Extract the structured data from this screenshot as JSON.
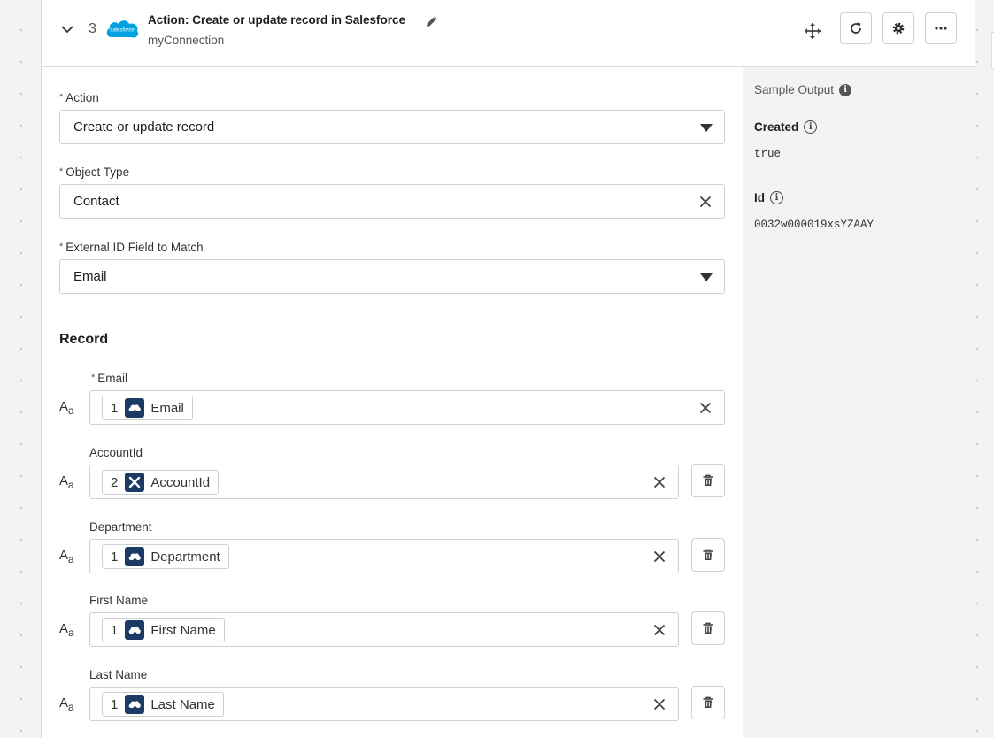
{
  "header": {
    "step_number": "3",
    "title": "Action: Create or update record in Salesforce",
    "subtitle": "myConnection",
    "logo_text": "salesforce"
  },
  "form": {
    "action": {
      "label": "Action",
      "value": "Create or update record"
    },
    "object_type": {
      "label": "Object Type",
      "value": "Contact"
    },
    "external_id": {
      "label": "External ID Field to Match",
      "value": "Email"
    }
  },
  "record": {
    "title": "Record",
    "type_icon": "Aa",
    "fields": [
      {
        "label": "Email",
        "chip_num": "1",
        "chip_label": "Email",
        "chip_icon": "salesforce-cloud-icon",
        "required": true
      },
      {
        "label": "AccountId",
        "chip_num": "2",
        "chip_label": "AccountId",
        "chip_icon": "integration-icon",
        "required": false
      },
      {
        "label": "Department",
        "chip_num": "1",
        "chip_label": "Department",
        "chip_icon": "salesforce-cloud-icon",
        "required": false
      },
      {
        "label": "First Name",
        "chip_num": "1",
        "chip_label": "First Name",
        "chip_icon": "salesforce-cloud-icon",
        "required": false
      },
      {
        "label": "Last Name",
        "chip_num": "1",
        "chip_label": "Last Name",
        "chip_icon": "salesforce-cloud-icon",
        "required": false
      }
    ]
  },
  "sample_output": {
    "title": "Sample Output",
    "created_label": "Created",
    "created_value": "true",
    "id_label": "Id",
    "id_value": "0032w000019xsYZAAY"
  },
  "required_marker": "*",
  "colors": {
    "chip_icon_bg": "#1b3a64",
    "salesforce_blue": "#00a1e0",
    "panel_bg": "#f3f3f3"
  }
}
